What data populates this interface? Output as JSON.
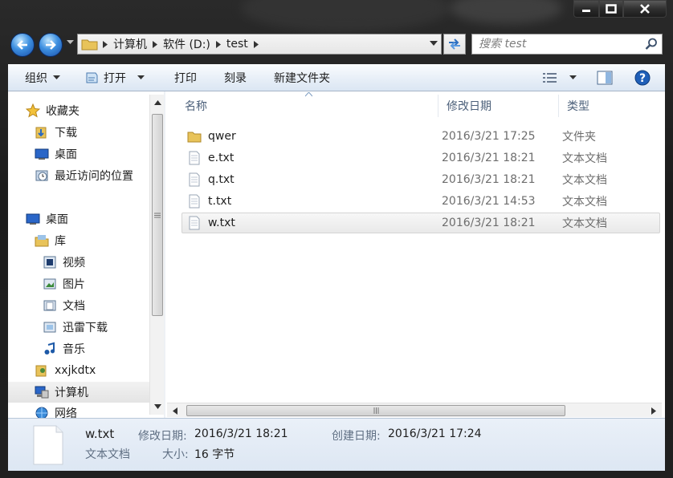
{
  "window": {
    "min_icon": "minimize-icon",
    "max_icon": "maximize-icon",
    "close_icon": "close-icon"
  },
  "address": {
    "crumbs": [
      "计算机",
      "软件 (D:)",
      "test"
    ]
  },
  "search": {
    "placeholder": "搜索 test"
  },
  "toolbar": {
    "organize": "组织",
    "open": "打开",
    "print": "打印",
    "burn": "刻录",
    "new_folder": "新建文件夹"
  },
  "nav_pane": {
    "favorites": "收藏夹",
    "downloads": "下载",
    "desktop_fav": "桌面",
    "recent": "最近访问的位置",
    "desktop": "桌面",
    "libraries": "库",
    "videos": "视频",
    "pictures": "图片",
    "documents": "文档",
    "thunder": "迅雷下载",
    "music": "音乐",
    "user": "xxjkdtx",
    "computer": "计算机",
    "network": "网络"
  },
  "columns": {
    "name": "名称",
    "date": "修改日期",
    "type": "类型"
  },
  "files": [
    {
      "name": "qwer",
      "date": "2016/3/21 17:25",
      "type": "文件夹",
      "icon": "folder-icon"
    },
    {
      "name": "e.txt",
      "date": "2016/3/21 18:21",
      "type": "文本文档",
      "icon": "text-file-icon"
    },
    {
      "name": "q.txt",
      "date": "2016/3/21 18:21",
      "type": "文本文档",
      "icon": "text-file-icon"
    },
    {
      "name": "t.txt",
      "date": "2016/3/21 14:53",
      "type": "文本文档",
      "icon": "text-file-icon"
    },
    {
      "name": "w.txt",
      "date": "2016/3/21 18:21",
      "type": "文本文档",
      "icon": "text-file-icon"
    }
  ],
  "details": {
    "name": "w.txt",
    "type": "文本文档",
    "modified_label": "修改日期:",
    "modified_value": "2016/3/21 18:21",
    "created_label": "创建日期:",
    "created_value": "2016/3/21 17:24",
    "size_label": "大小:",
    "size_value": "16 字节"
  }
}
